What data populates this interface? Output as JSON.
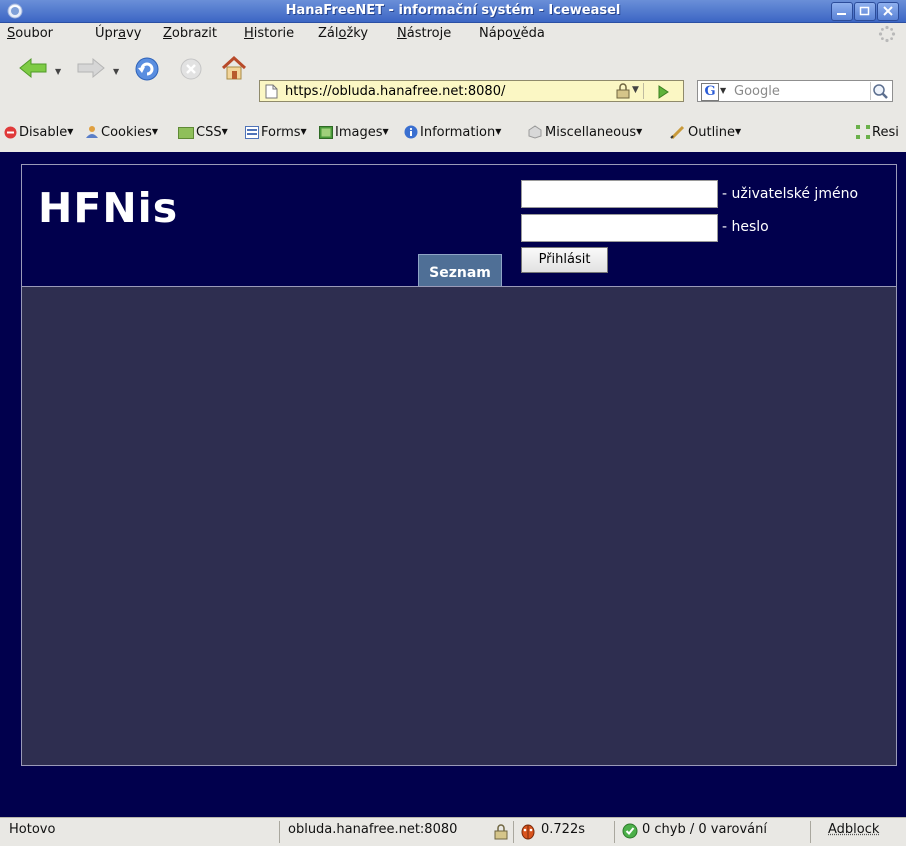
{
  "window": {
    "title": "HanaFreeNET - informační systém - Iceweasel"
  },
  "menu": [
    {
      "pre": "",
      "ul": "S",
      "post": "oubor"
    },
    {
      "pre": "Úpr",
      "ul": "a",
      "post": "vy"
    },
    {
      "pre": "",
      "ul": "Z",
      "post": "obrazit"
    },
    {
      "pre": "",
      "ul": "H",
      "post": "istorie"
    },
    {
      "pre": "Zál",
      "ul": "o",
      "post": "žky"
    },
    {
      "pre": "",
      "ul": "N",
      "post": "ástroje"
    },
    {
      "pre": "Nápo",
      "ul": "v",
      "post": "ěda"
    }
  ],
  "navbar": {
    "url": "https://obluda.hanafree.net:8080/",
    "search_placeholder": "Google"
  },
  "devtoolbar": {
    "items": [
      "Disable",
      "Cookies",
      "CSS",
      "Forms",
      "Images",
      "Information",
      "Miscellaneous",
      "Outline",
      "Resi"
    ]
  },
  "page": {
    "logo": "HFNis",
    "tab_label": "Seznam",
    "username_label": "- uživatelské jméno",
    "password_label": "- heslo",
    "username_value": "",
    "password_value": "",
    "login_button": "Přihlásit"
  },
  "status": {
    "text": "Hotovo",
    "host": "obluda.hanafree.net:8080",
    "time": "0.722s",
    "validation": "0 chyb / 0 varování",
    "adblock": "Adblock"
  },
  "colors": {
    "page_bg": "#01004d",
    "content_bg": "#2e2e50",
    "tab_bg": "#4f6f96",
    "titlebar": "#3c66c4"
  }
}
